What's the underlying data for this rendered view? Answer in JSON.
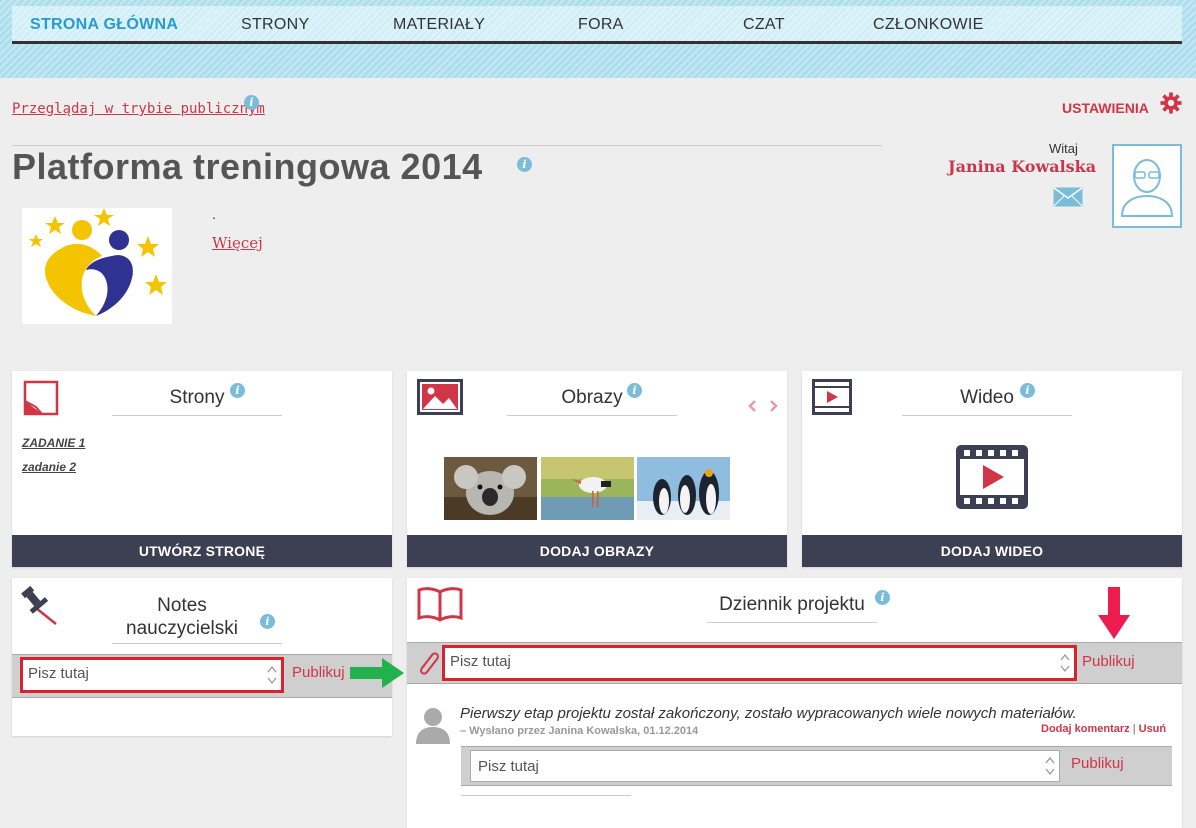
{
  "nav": {
    "items": [
      "STRONA GŁÓWNA",
      "STRONY",
      "MATERIAŁY",
      "FORA",
      "CZAT",
      "CZŁONKOWIE"
    ]
  },
  "public_view_link": "Przeglądaj w trybie publicznym",
  "settings_label": "USTAWIENIA",
  "page_title": "Platforma treningowa 2014",
  "description_dot": ".",
  "more_link": "Więcej",
  "user": {
    "greeting": "Witaj",
    "name": "Janina Kowalska"
  },
  "info_glyph": "i",
  "pages_panel": {
    "title": "Strony",
    "links": [
      "ZADANIE 1",
      "zadanie 2"
    ],
    "button": "UTWÓRZ STRONĘ"
  },
  "images_panel": {
    "title": "Obrazy",
    "button": "DODAJ OBRAZY"
  },
  "video_panel": {
    "title": "Wideo",
    "button": "DODAJ WIDEO"
  },
  "notes_panel": {
    "title_line1": "Notes",
    "title_line2": "nauczycielski",
    "placeholder": "Pisz tutaj",
    "publish": "Publikuj"
  },
  "journal_panel": {
    "title": "Dziennik projektu",
    "placeholder": "Pisz tutaj",
    "publish": "Publikuj",
    "post": {
      "text": "Pierwszy etap projektu został zakończony, zostało wypracowanych wiele nowych materiałów.",
      "meta": "– Wysłano przez Janina Kowalska, 01.12.2014",
      "add_comment": "Dodaj komentarz",
      "separator": "|",
      "delete": "Usuń"
    },
    "comment_placeholder": "Pisz tutaj",
    "comment_publish": "Publikuj"
  },
  "colors": {
    "accent_red": "#d03548",
    "nav_active": "#2a9ad0",
    "button_dark": "#3d3f52",
    "highlight_red": "#d8232f",
    "arrow_green": "#22b14c",
    "arrow_pink": "#ed1c4f"
  }
}
